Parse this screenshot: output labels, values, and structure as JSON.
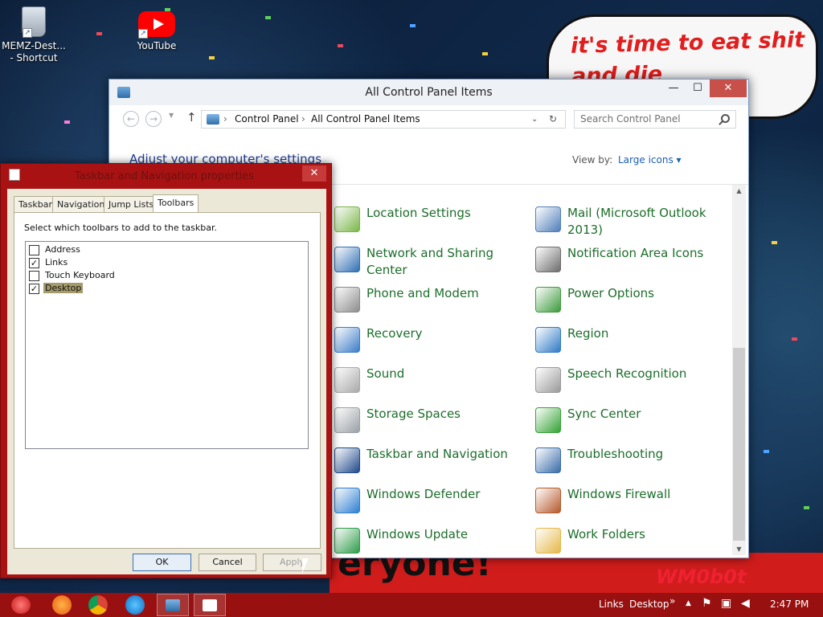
{
  "desktop": {
    "icons": [
      {
        "label": "MEMZ-Dest... - Shortcut",
        "icon": "recycle-bin-icon"
      },
      {
        "label": "YouTube",
        "icon": "youtube-icon"
      }
    ],
    "bubble_text": "it's time to eat shit and die andcelebrate",
    "banner_text": "eryone!",
    "banner_tag": "WM0b0t"
  },
  "control_panel": {
    "title": "All Control Panel Items",
    "window_buttons": {
      "minimize": "—",
      "maximize": "☐",
      "close": "✕"
    },
    "address": {
      "crumb1": "Control Panel",
      "crumb2": "All Control Panel Items",
      "sep": "›"
    },
    "search_placeholder": "Search Control Panel",
    "heading": "Adjust your computer's settings",
    "view_by_label": "View by:",
    "view_by_value": "Large icons ▾",
    "items_left": [
      {
        "label": "Location Settings",
        "icon": "location-icon",
        "color": "#7ab648"
      },
      {
        "label": "Network and Sharing Center",
        "icon": "network-icon",
        "color": "#2f6fb3"
      },
      {
        "label": "Phone and Modem",
        "icon": "phone-icon",
        "color": "#8c8c8c"
      },
      {
        "label": "Recovery",
        "icon": "recovery-icon",
        "color": "#3b7dc8"
      },
      {
        "label": "Sound",
        "icon": "sound-icon",
        "color": "#a9a9a9"
      },
      {
        "label": "Storage Spaces",
        "icon": "storage-icon",
        "color": "#9aa0a6"
      },
      {
        "label": "Taskbar and Navigation",
        "icon": "taskbar-icon",
        "color": "#1f4a8a"
      },
      {
        "label": "Windows Defender",
        "icon": "defender-icon",
        "color": "#2d7fd1"
      },
      {
        "label": "Windows Update",
        "icon": "update-icon",
        "color": "#2e9c4a"
      }
    ],
    "items_right": [
      {
        "label": "Mail (Microsoft Outlook 2013)",
        "icon": "mail-icon",
        "color": "#4f7fb8"
      },
      {
        "label": "Notification Area Icons",
        "icon": "notification-icon",
        "color": "#6d6d6d"
      },
      {
        "label": "Power Options",
        "icon": "power-icon",
        "color": "#3d9a3d"
      },
      {
        "label": "Region",
        "icon": "region-icon",
        "color": "#2e7bc4"
      },
      {
        "label": "Speech Recognition",
        "icon": "microphone-icon",
        "color": "#9a9a9a"
      },
      {
        "label": "Sync Center",
        "icon": "sync-icon",
        "color": "#33a233"
      },
      {
        "label": "Troubleshooting",
        "icon": "troubleshoot-icon",
        "color": "#3a6ca8"
      },
      {
        "label": "Windows Firewall",
        "icon": "firewall-icon",
        "color": "#b55a2c"
      },
      {
        "label": "Work Folders",
        "icon": "folder-icon",
        "color": "#e6b84a"
      }
    ]
  },
  "dialog": {
    "title": "Taskbar and Navigation properties",
    "close": "✕",
    "tabs": [
      "Taskbar",
      "Navigation",
      "Jump Lists",
      "Toolbars"
    ],
    "active_tab": "Toolbars",
    "instruction": "Select which toolbars to add to the taskbar.",
    "toolbars": [
      {
        "label": "Address",
        "checked": false,
        "mark": ""
      },
      {
        "label": "Links",
        "checked": true,
        "mark": "✓"
      },
      {
        "label": "Touch Keyboard",
        "checked": false,
        "mark": ""
      },
      {
        "label": "Desktop",
        "checked": true,
        "mark": "✓"
      }
    ],
    "buttons": {
      "ok": "OK",
      "cancel": "Cancel",
      "apply": "Apply"
    }
  },
  "taskbar": {
    "links": "Links",
    "desktop": "Desktop",
    "chevron": "»",
    "clock": "2:47 PM",
    "tray_up": "▲",
    "apps": [
      "firefox-icon",
      "chrome-icon",
      "edge-icon",
      "control-panel-icon",
      "taskbar-properties-icon"
    ],
    "accent": "#981010"
  }
}
